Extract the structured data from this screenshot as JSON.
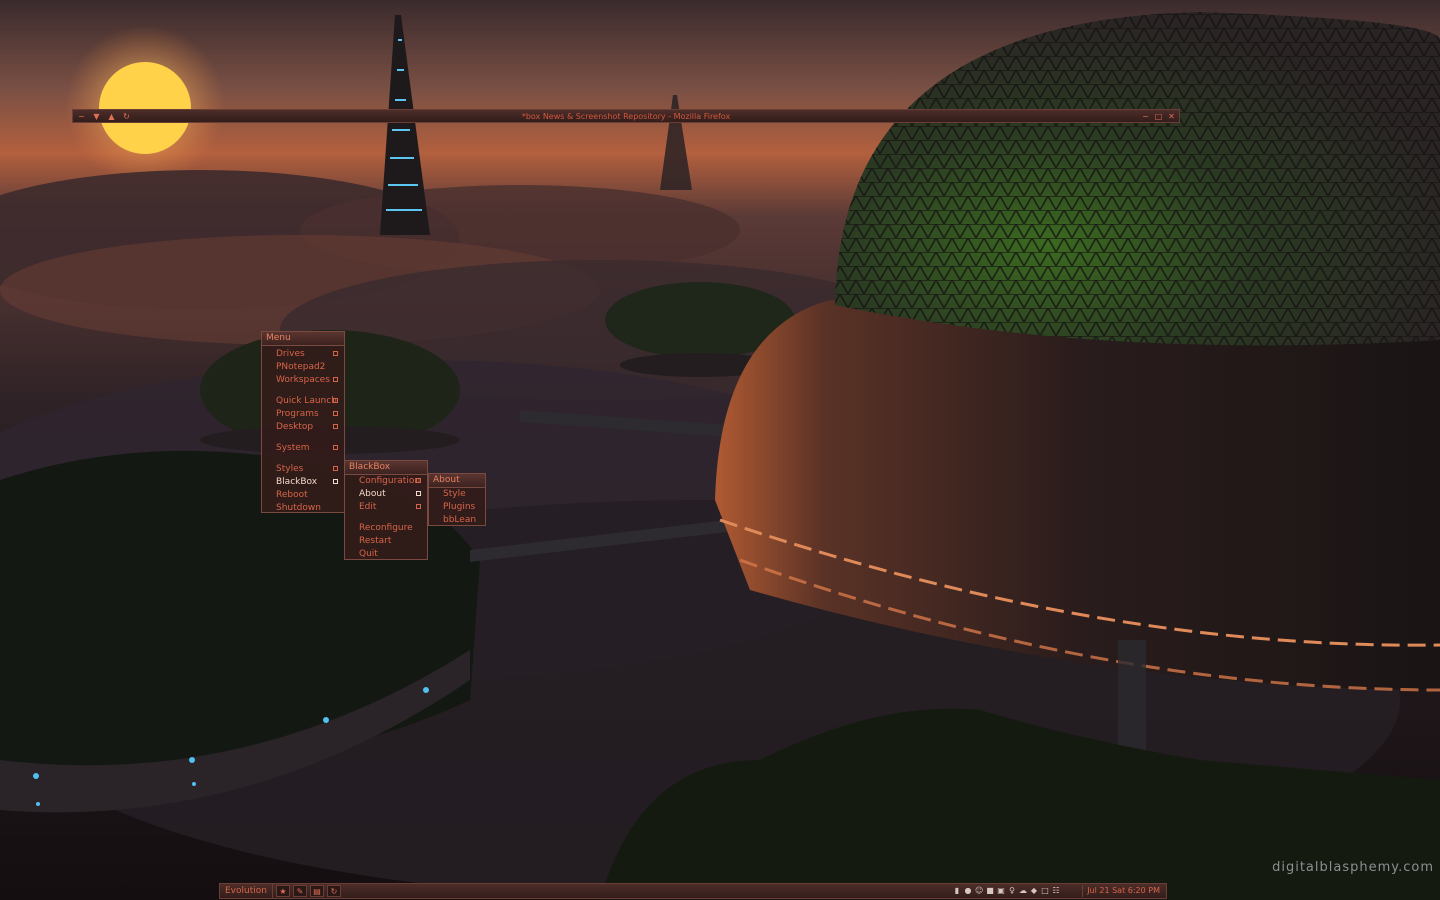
{
  "window": {
    "title": "*box News & Screenshot Repository - Mozilla Firefox"
  },
  "menus": {
    "root": {
      "title": "Menu",
      "items": [
        {
          "label": "Drives",
          "submenu": true
        },
        {
          "label": "PNotepad2",
          "submenu": false
        },
        {
          "label": "Workspaces",
          "submenu": true
        },
        {
          "label": "Quick Launch",
          "submenu": true
        },
        {
          "label": "Programs",
          "submenu": true
        },
        {
          "label": "Desktop",
          "submenu": true
        },
        {
          "label": "System",
          "submenu": true
        },
        {
          "label": "Styles",
          "submenu": true
        },
        {
          "label": "BlackBox",
          "submenu": true,
          "active": true
        },
        {
          "label": "Reboot",
          "submenu": false
        },
        {
          "label": "Shutdown",
          "submenu": false
        }
      ]
    },
    "blackbox": {
      "title": "BlackBox",
      "items": [
        {
          "label": "Configuration",
          "submenu": true
        },
        {
          "label": "About",
          "submenu": true,
          "active": true
        },
        {
          "label": "Edit",
          "submenu": true
        },
        {
          "label": "Reconfigure",
          "submenu": false
        },
        {
          "label": "Restart",
          "submenu": false
        },
        {
          "label": "Quit",
          "submenu": false
        }
      ]
    },
    "about": {
      "title": "About",
      "items": [
        {
          "label": "Style"
        },
        {
          "label": "Plugins"
        },
        {
          "label": "bbLean"
        }
      ]
    }
  },
  "toolbar": {
    "workspace": "Evolution",
    "clock": "Jul 21 Sat 6:20 PM",
    "buttons": [
      "tool-icon-1",
      "tool-icon-2",
      "tool-icon-3",
      "tool-icon-4"
    ]
  },
  "watermark": "digitalblasphemy.com",
  "colors": {
    "accent": "#e86a4c",
    "highlight": "#f4d9c8",
    "panel": "#3d2320"
  }
}
